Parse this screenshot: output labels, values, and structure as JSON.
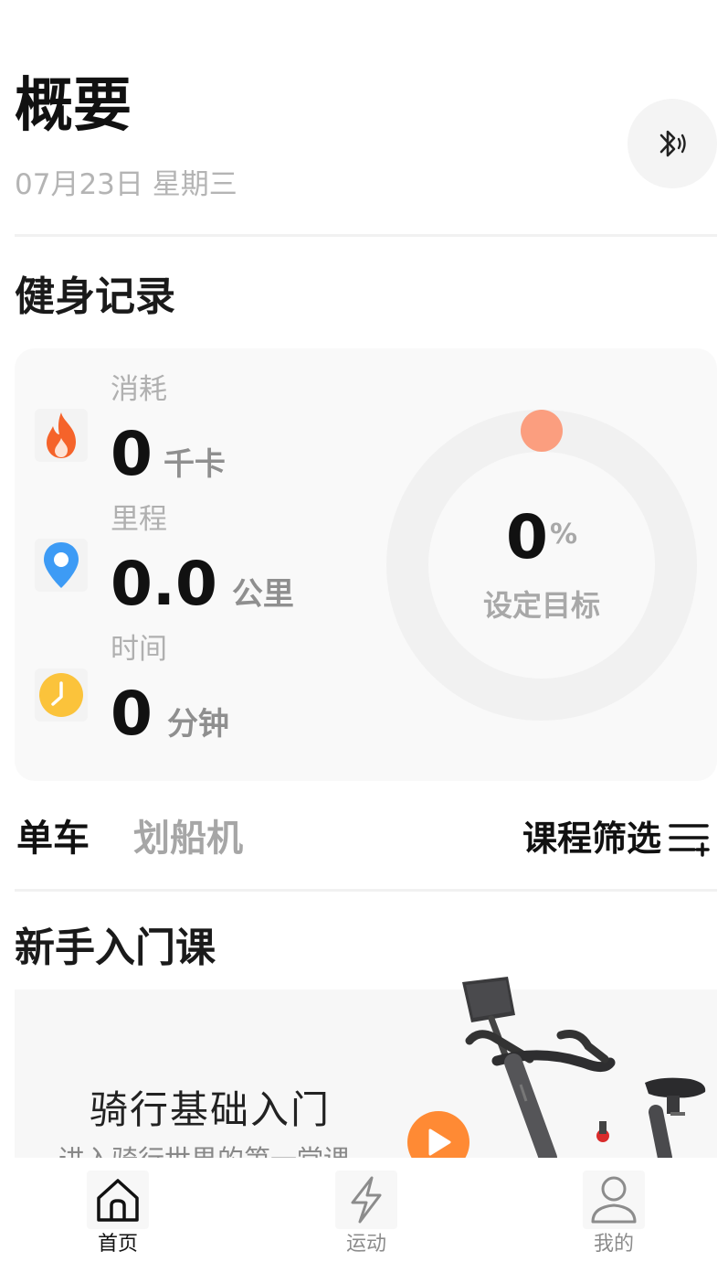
{
  "header": {
    "title": "概要",
    "date": "07月23日 星期三"
  },
  "fitness": {
    "section_title": "健身记录",
    "calories": {
      "label": "消耗",
      "value": "0",
      "unit": "千卡",
      "icon": "flame-icon",
      "color": "#f5632a"
    },
    "distance": {
      "label": "里程",
      "value": "0.0",
      "unit": "公里",
      "icon": "location-pin-icon",
      "color": "#3d9bf5"
    },
    "time": {
      "label": "时间",
      "value": "0",
      "unit": "分钟",
      "icon": "clock-icon",
      "color": "#fbc33b"
    },
    "goal": {
      "percent": "0",
      "percent_sign": "%",
      "label": "设定目标",
      "progress": 0,
      "dot_color": "#fb9e7f"
    }
  },
  "tabs": {
    "items": [
      {
        "label": "单车",
        "active": true
      },
      {
        "label": "划船机",
        "active": false
      }
    ],
    "filter_label": "课程筛选"
  },
  "beginner": {
    "section_title": "新手入门课",
    "course_title": "骑行基础入门",
    "course_subtitle": "进入骑行世界的第一堂课",
    "play_color": "#ff8a34"
  },
  "bottom_nav": {
    "items": [
      {
        "label": "首页",
        "icon": "home-icon",
        "active": true
      },
      {
        "label": "运动",
        "icon": "lightning-icon",
        "active": false
      },
      {
        "label": "我的",
        "icon": "user-icon",
        "active": false
      }
    ]
  }
}
